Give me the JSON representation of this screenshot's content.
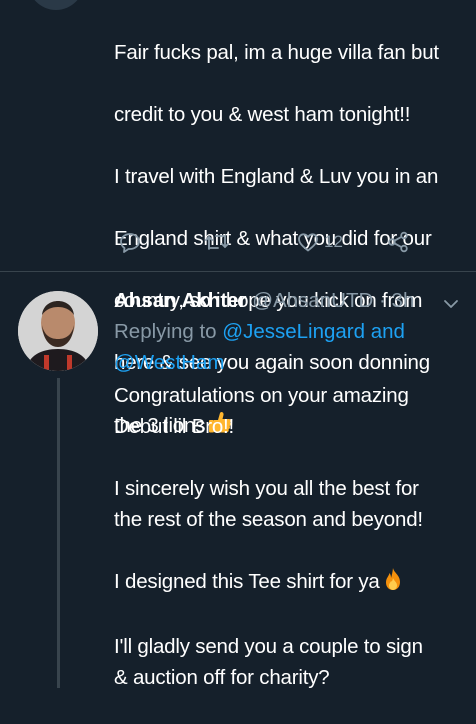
{
  "tweet1": {
    "lines": [
      "Fair fucks pal, im a huge villa fan but",
      "credit to you & west ham tonight!!",
      "I travel with England & Luv you in an",
      "England shirt & what you did for our",
      "country, so i hope you kick on from",
      "here & see you again soon donning",
      "the 3 lions"
    ],
    "emoji": "thumbs-up",
    "like_count": "12"
  },
  "tweet2": {
    "name": "Ahsan Akhter",
    "handle": "@AhsanUTD",
    "separator": "·",
    "time": "3h",
    "replying_prefix": "Replying to",
    "mention_1": "@JesseLingard",
    "mention_joiner": "and",
    "mention_2": "@WestHam",
    "para1_line1": "Congratulations on your amazing",
    "para1_line2": "Debut lil Bro!!",
    "para2_line1": "I sincerely wish you all the best for",
    "para2_line2": "the rest of the season and beyond!",
    "para3": "I designed this Tee shirt for ya",
    "para3_emoji": "fire",
    "para4_line1": "I'll gladly send you a couple to sign",
    "para4_line2": "& auction off for charity?"
  },
  "colors": {
    "background": "#15202b",
    "secondary_text": "#8899a6",
    "link": "#1da1f2",
    "divider": "#38444d"
  }
}
